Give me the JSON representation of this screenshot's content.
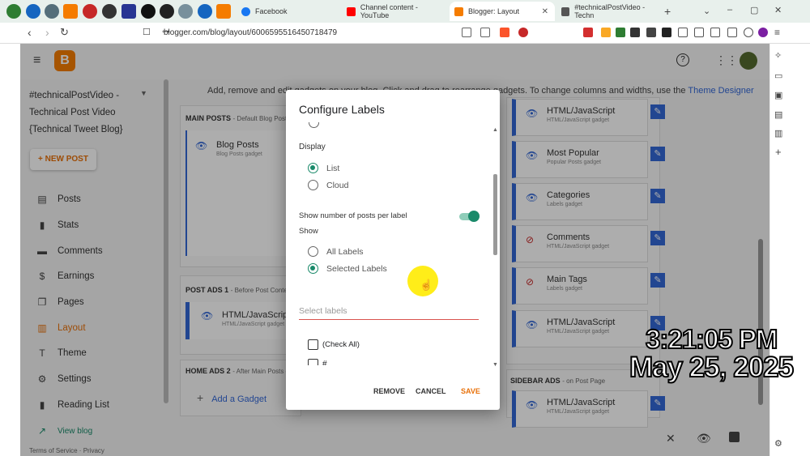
{
  "browser": {
    "tabs": [
      {
        "label": "Facebook",
        "fav_color": "#1877f2"
      },
      {
        "label": "Channel content - YouTube",
        "fav_color": "#ff0000"
      },
      {
        "label": "Blogger: Layout",
        "fav_color": "#f57c00"
      },
      {
        "label": "#technicalPostVideo - Techn",
        "fav_color": "#444"
      }
    ],
    "new_tab": "+",
    "url": "blogger.com/blog/layout/6006595516450718479",
    "window_controls": [
      "⌄",
      "–",
      "▢",
      "✕"
    ]
  },
  "blogger": {
    "blog_name_line1": "#technicalPostVideo -",
    "blog_name_line2": "Technical Post Video",
    "blog_name_line3": "{Technical Tweet Blog}",
    "new_post": "+ NEW POST",
    "nav": [
      {
        "label": "Posts",
        "icon": "posts-icon",
        "glyph": "▤"
      },
      {
        "label": "Stats",
        "icon": "stats-icon",
        "glyph": "▮"
      },
      {
        "label": "Comments",
        "icon": "comments-icon",
        "glyph": "▬"
      },
      {
        "label": "Earnings",
        "icon": "dollar-icon",
        "glyph": "$"
      },
      {
        "label": "Pages",
        "icon": "pages-icon",
        "glyph": "❐"
      },
      {
        "label": "Layout",
        "icon": "layout-icon",
        "glyph": "▥"
      },
      {
        "label": "Theme",
        "icon": "theme-icon",
        "glyph": "T"
      },
      {
        "label": "Settings",
        "icon": "gear-icon",
        "glyph": "⚙"
      },
      {
        "label": "Reading List",
        "icon": "bookmark-icon",
        "glyph": "▮"
      }
    ],
    "view_blog": "View blog",
    "footer_terms": "Terms of Service",
    "footer_privacy": "Privacy",
    "hint_text": "Add, remove and edit gadgets on your blog. Click and drag to rearrange gadgets. To change columns and widths, use the",
    "theme_designer_link": "Theme Designer",
    "sections": {
      "main_posts": {
        "title": "MAIN POSTS",
        "sub": "- Default Blog Posts"
      },
      "post_ads": {
        "title": "POST ADS 1",
        "sub": "- Before Post Content"
      },
      "home_ads": {
        "title": "HOME ADS 2",
        "sub": "- After Main Posts o"
      },
      "sidebar_ads": {
        "title": "SIDEBAR ADS",
        "sub": "- on Post Page"
      }
    },
    "blog_posts_gadget": {
      "title": "Blog Posts",
      "sub": "Blog Posts gadget"
    },
    "post_ads_gadget": {
      "title": "HTML/JavaScript",
      "sub": "HTML/JavaScript gadget"
    },
    "add_gadget": "Add a Gadget",
    "right_gadgets": [
      {
        "title": "HTML/JavaScript",
        "sub": "HTML/JavaScript gadget",
        "hidden": false
      },
      {
        "title": "Most Popular",
        "sub": "Popular Posts gadget",
        "hidden": false
      },
      {
        "title": "Categories",
        "sub": "Labels gadget",
        "hidden": false
      },
      {
        "title": "Comments",
        "sub": "HTML/JavaScript gadget",
        "hidden": true
      },
      {
        "title": "Main Tags",
        "sub": "Labels gadget",
        "hidden": true
      },
      {
        "title": "HTML/JavaScript",
        "sub": "HTML/JavaScript gadget",
        "hidden": false
      }
    ],
    "sidebar_gadget": {
      "title": "HTML/JavaScript",
      "sub": "HTML/JavaScript gadget"
    }
  },
  "modal": {
    "title": "Configure Labels",
    "display_label": "Display",
    "display_options": [
      "List",
      "Cloud"
    ],
    "display_selected": "List",
    "show_count_label": "Show number of posts per label",
    "show_count_on": true,
    "show_label": "Show",
    "show_options": [
      "All Labels",
      "Selected Labels"
    ],
    "show_selected": "Selected Labels",
    "select_placeholder": "Select labels",
    "checkboxes": [
      "(Check All)",
      "#"
    ],
    "buttons": {
      "remove": "REMOVE",
      "cancel": "CANCEL",
      "save": "SAVE"
    },
    "accent": "#1a8a6a",
    "save_color": "#e8710a"
  },
  "overlay_clock": {
    "time": "3:21:05 PM",
    "date": "May 25, 2025"
  }
}
